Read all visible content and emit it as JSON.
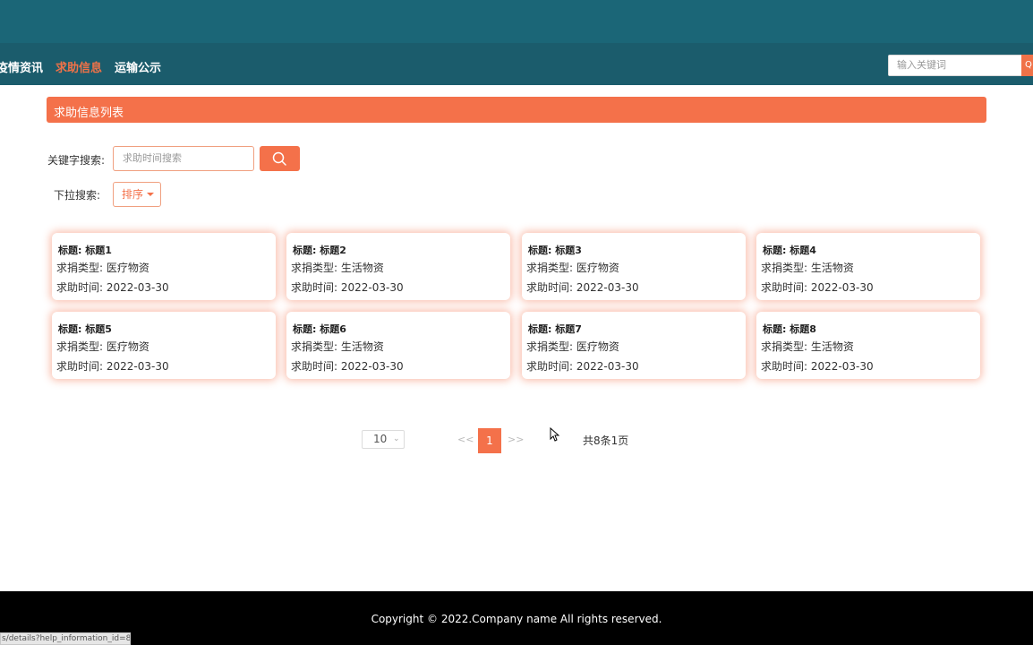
{
  "nav": {
    "items": [
      {
        "label": "疫情资讯",
        "active": false
      },
      {
        "label": "求助信息",
        "active": true
      },
      {
        "label": "运输公示",
        "active": false
      }
    ],
    "search_placeholder": "输入关键词"
  },
  "section": {
    "title": "求助信息列表"
  },
  "filters": {
    "keyword_label": "关键字搜索:",
    "keyword_placeholder": "求助时间搜索",
    "dropdown_label": "下拉搜索:",
    "sort_label": "排序"
  },
  "cards": [
    {
      "title": "标题: 标题1",
      "type": "求捐类型: 医疗物资",
      "time": "求助时间: 2022-03-30"
    },
    {
      "title": "标题: 标题2",
      "type": "求捐类型: 生活物资",
      "time": "求助时间: 2022-03-30"
    },
    {
      "title": "标题: 标题3",
      "type": "求捐类型: 医疗物资",
      "time": "求助时间: 2022-03-30"
    },
    {
      "title": "标题: 标题4",
      "type": "求捐类型: 生活物资",
      "time": "求助时间: 2022-03-30"
    },
    {
      "title": "标题: 标题5",
      "type": "求捐类型: 医疗物资",
      "time": "求助时间: 2022-03-30"
    },
    {
      "title": "标题: 标题6",
      "type": "求捐类型: 生活物资",
      "time": "求助时间: 2022-03-30"
    },
    {
      "title": "标题: 标题7",
      "type": "求捐类型: 医疗物资",
      "time": "求助时间: 2022-03-30"
    },
    {
      "title": "标题: 标题8",
      "type": "求捐类型: 生活物资",
      "time": "求助时间: 2022-03-30"
    }
  ],
  "pagination": {
    "page_size": "10",
    "prev": "<<",
    "current": "1",
    "next": ">>",
    "total": "共8条1页"
  },
  "footer": {
    "copyright": "Copyright © 2022.Company name All rights reserved."
  },
  "statusbar": {
    "url": "s/details?help_information_id=8"
  },
  "colors": {
    "accent": "#f4714a",
    "nav_bg": "#1b5c6c",
    "top_bg": "#1b6677",
    "footer_bg": "#000000"
  }
}
